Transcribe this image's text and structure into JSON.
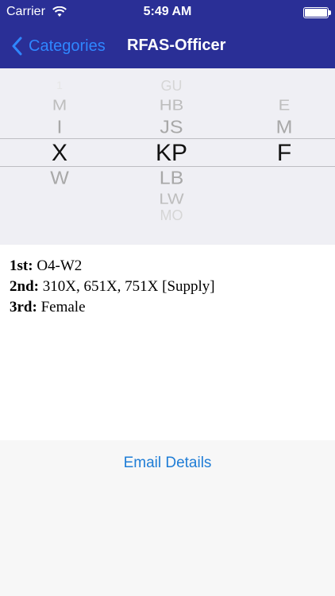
{
  "status_bar": {
    "carrier": "Carrier",
    "time": "5:49 AM",
    "battery_level": 1.0
  },
  "nav": {
    "back_label": "Categories",
    "title": "RFAS-Officer",
    "back_color": "#2f87ff",
    "bar_color": "#2a2f96"
  },
  "picker": {
    "col1": [
      "1",
      "M",
      "I",
      "X",
      "W"
    ],
    "col2": [
      "GU",
      "HB",
      "JS",
      "KP",
      "LB",
      "LW",
      "MO"
    ],
    "col3": [
      "E",
      "M",
      "F"
    ],
    "selected": {
      "col1": "X",
      "col2": "KP",
      "col3": "F"
    }
  },
  "details": {
    "first_label": "1st:",
    "first_value": "O4-W2",
    "second_label": "2nd:",
    "second_value": "310X, 651X, 751X [Supply]",
    "third_label": "3rd:",
    "third_value": "Female"
  },
  "actions": {
    "email_label": "Email Details",
    "email_color": "#1f7dd6"
  }
}
